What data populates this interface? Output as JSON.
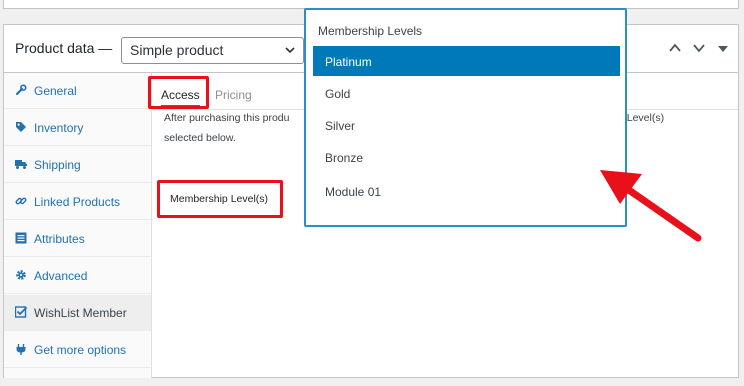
{
  "product_panel": {
    "title": "Product data —",
    "product_type": "Simple product"
  },
  "sidebar": {
    "items": [
      {
        "label": "General",
        "icon": "wrench-icon"
      },
      {
        "label": "Inventory",
        "icon": "tag-icon"
      },
      {
        "label": "Shipping",
        "icon": "truck-icon"
      },
      {
        "label": "Linked Products",
        "icon": "link-icon"
      },
      {
        "label": "Attributes",
        "icon": "list-icon"
      },
      {
        "label": "Advanced",
        "icon": "gear-icon"
      },
      {
        "label": "WishList Member",
        "icon": "checkbox-icon"
      },
      {
        "label": "Get more options",
        "icon": "plugin-icon"
      }
    ]
  },
  "tabs": {
    "access": "Access",
    "pricing": "Pricing"
  },
  "access": {
    "description_start": "After purchasing this produ",
    "description_continued": "p Level(s)",
    "description_line2": "selected below.",
    "membership_button": "Membership Level(s)"
  },
  "dropdown": {
    "title": "Membership Levels",
    "options": [
      "Platinum",
      "Gold",
      "Silver",
      "Bronze",
      "Module 01"
    ],
    "selected": "Platinum"
  },
  "colors": {
    "highlight": "#e8101a",
    "link": "#2271b1",
    "selected": "#0079b8",
    "dropdown_border": "#2b8ec6"
  }
}
